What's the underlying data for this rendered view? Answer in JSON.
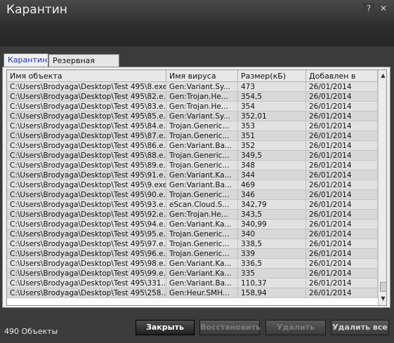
{
  "window": {
    "title": "Карантин"
  },
  "titlebar_buttons": {
    "help": "?",
    "close": "✕"
  },
  "tabs": [
    {
      "label": "Карантин"
    },
    {
      "label": "Резервная копия"
    }
  ],
  "table": {
    "columns": [
      "Имя объекта",
      "Имя вируса",
      "Размер(кБ)",
      "Добавлен в"
    ],
    "rows": [
      [
        "C:\\Users\\Brodyaga\\Desktop\\Test 495\\8.exe",
        "Gen:Variant.Sy...",
        "473",
        "26/01/2014"
      ],
      [
        "C:\\Users\\Brodyaga\\Desktop\\Test 495\\82.e...",
        "Gen:Trojan.He...",
        "354,5",
        "26/01/2014"
      ],
      [
        "C:\\Users\\Brodyaga\\Desktop\\Test 495\\83.e...",
        "Gen:Trojan.He...",
        "354",
        "26/01/2014"
      ],
      [
        "C:\\Users\\Brodyaga\\Desktop\\Test 495\\85.e...",
        "Gen:Variant.Sy...",
        "352,01",
        "26/01/2014"
      ],
      [
        "C:\\Users\\Brodyaga\\Desktop\\Test 495\\84.e...",
        "Trojan.Generic...",
        "353",
        "26/01/2014"
      ],
      [
        "C:\\Users\\Brodyaga\\Desktop\\Test 495\\87.e...",
        "Trojan.Generic...",
        "351",
        "26/01/2014"
      ],
      [
        "C:\\Users\\Brodyaga\\Desktop\\Test 495\\86.e...",
        "Gen:Variant.Ba...",
        "352",
        "26/01/2014"
      ],
      [
        "C:\\Users\\Brodyaga\\Desktop\\Test 495\\88.e...",
        "Trojan.Generic...",
        "349,5",
        "26/01/2014"
      ],
      [
        "C:\\Users\\Brodyaga\\Desktop\\Test 495\\89.e...",
        "Trojan.Generic...",
        "348",
        "26/01/2014"
      ],
      [
        "C:\\Users\\Brodyaga\\Desktop\\Test 495\\91.e...",
        "Gen:Variant.Ka...",
        "344",
        "26/01/2014"
      ],
      [
        "C:\\Users\\Brodyaga\\Desktop\\Test 495\\9.exe",
        "Gen:Variant.Ba...",
        "469",
        "26/01/2014"
      ],
      [
        "C:\\Users\\Brodyaga\\Desktop\\Test 495\\90.e...",
        "Trojan.Generic...",
        "346",
        "26/01/2014"
      ],
      [
        "C:\\Users\\Brodyaga\\Desktop\\Test 495\\93.e...",
        "eScan.Cloud.S...",
        "342,79",
        "26/01/2014"
      ],
      [
        "C:\\Users\\Brodyaga\\Desktop\\Test 495\\92.e...",
        "Gen:Trojan.He...",
        "343,5",
        "26/01/2014"
      ],
      [
        "C:\\Users\\Brodyaga\\Desktop\\Test 495\\94.e...",
        "Gen:Variant.Ka...",
        "340,99",
        "26/01/2014"
      ],
      [
        "C:\\Users\\Brodyaga\\Desktop\\Test 495\\95.e...",
        "Trojan.Generic...",
        "340",
        "26/01/2014"
      ],
      [
        "C:\\Users\\Brodyaga\\Desktop\\Test 495\\97.e...",
        "Trojan.Generic...",
        "338,5",
        "26/01/2014"
      ],
      [
        "C:\\Users\\Brodyaga\\Desktop\\Test 495\\96.e...",
        "Trojan.Generic...",
        "339",
        "26/01/2014"
      ],
      [
        "C:\\Users\\Brodyaga\\Desktop\\Test 495\\98.e...",
        "Gen:Variant.Ka...",
        "336,5",
        "26/01/2014"
      ],
      [
        "C:\\Users\\Brodyaga\\Desktop\\Test 495\\99.e...",
        "Gen:Variant.Ka...",
        "335",
        "26/01/2014"
      ],
      [
        "C:\\Users\\Brodyaga\\Desktop\\Test 495\\331...",
        "Gen:Variant.Ba...",
        "110,37",
        "26/01/2014"
      ],
      [
        "C:\\Users\\Brodyaga\\Desktop\\Test 495\\258...",
        "Gen:Heur.SMH...",
        "158,94",
        "26/01/2014"
      ]
    ]
  },
  "scrollbar": {
    "up_icon": "▲",
    "down_icon": "▼"
  },
  "footer": {
    "count": "490 Объекты"
  },
  "buttons": {
    "close": "Закрыть",
    "restore": "Восстановить",
    "delete": "Удалить",
    "delete_all": "Удалить все"
  },
  "colors": {
    "accent_tab_text": "#1a33c8",
    "window_bg": "#3a3a3a"
  }
}
